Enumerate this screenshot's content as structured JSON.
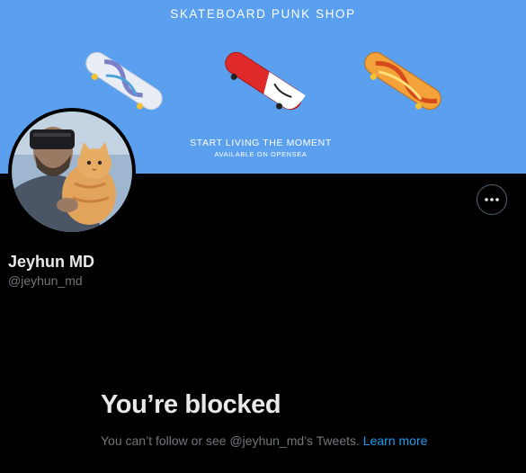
{
  "banner": {
    "title": "SKATEBOARD PUNK SHOP",
    "subtitle": "START LIVING THE MOMENT",
    "subtitle2": "AVAILABLE ON OPENSEA",
    "background": "#5aa0ee"
  },
  "profile": {
    "display_name": "Jeyhun MD",
    "handle": "@jeyhun_md"
  },
  "more_button": {
    "icon": "more-horizontal-icon"
  },
  "blocked": {
    "title": "You’re blocked",
    "description": "You can’t follow or see @jeyhun_md’s Tweets.",
    "link_text": "Learn more"
  },
  "colors": {
    "background": "#000000",
    "primary_text": "#e7e9ea",
    "secondary_text": "#71767b",
    "link": "#1d9bf0"
  }
}
